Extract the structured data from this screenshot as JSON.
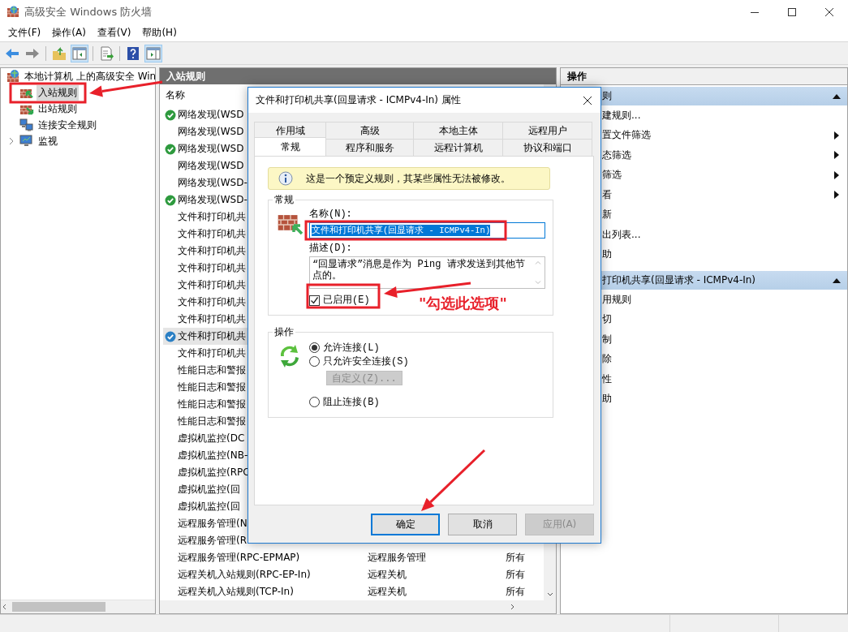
{
  "window": {
    "title": "高级安全 Windows 防火墙"
  },
  "menu": [
    "文件(F)",
    "操作(A)",
    "查看(V)",
    "帮助(H)"
  ],
  "tree": {
    "root": "本地计算机 上的高级安全 Win",
    "children": [
      {
        "label": "入站规则",
        "selected": true,
        "kind": "inbound"
      },
      {
        "label": "出站规则",
        "selected": false,
        "kind": "outbound"
      },
      {
        "label": "连接安全规则",
        "selected": false,
        "kind": "security"
      },
      {
        "label": "监视",
        "selected": false,
        "kind": "monitor"
      }
    ]
  },
  "rules_panel": {
    "title": "入站规则",
    "columns": [
      "名称"
    ],
    "rows": [
      {
        "name": "网络发现(WSD",
        "enabled": true,
        "selected": false
      },
      {
        "name": "网络发现(WSD",
        "enabled": false,
        "selected": false
      },
      {
        "name": "网络发现(WSD",
        "enabled": true,
        "selected": false
      },
      {
        "name": "网络发现(WSD",
        "enabled": false,
        "selected": false
      },
      {
        "name": "网络发现(WSD-",
        "enabled": false,
        "selected": false
      },
      {
        "name": "网络发现(WSD-",
        "enabled": true,
        "selected": false
      },
      {
        "name": "文件和打印机共",
        "enabled": false,
        "selected": false
      },
      {
        "name": "文件和打印机共",
        "enabled": false,
        "selected": false
      },
      {
        "name": "文件和打印机共",
        "enabled": false,
        "selected": false
      },
      {
        "name": "文件和打印机共",
        "enabled": false,
        "selected": false
      },
      {
        "name": "文件和打印机共",
        "enabled": false,
        "selected": false
      },
      {
        "name": "文件和打印机共",
        "enabled": false,
        "selected": false
      },
      {
        "name": "文件和打印机共",
        "enabled": false,
        "selected": false
      },
      {
        "name": "文件和打印机共",
        "enabled": true,
        "selected": true
      },
      {
        "name": "文件和打印机共",
        "enabled": false,
        "selected": false
      },
      {
        "name": "性能日志和警报",
        "enabled": false,
        "selected": false
      },
      {
        "name": "性能日志和警报",
        "enabled": false,
        "selected": false
      },
      {
        "name": "性能日志和警报",
        "enabled": false,
        "selected": false
      },
      {
        "name": "性能日志和警报",
        "enabled": false,
        "selected": false
      },
      {
        "name": "虚拟机监控(DC",
        "enabled": false,
        "selected": false
      },
      {
        "name": "虚拟机监控(NB-",
        "enabled": false,
        "selected": false
      },
      {
        "name": "虚拟机监控(RPC",
        "enabled": false,
        "selected": false
      },
      {
        "name": "虚拟机监控(回",
        "enabled": false,
        "selected": false
      },
      {
        "name": "虚拟机监控(回",
        "enabled": false,
        "selected": false
      },
      {
        "name": "远程服务管理(N",
        "enabled": false,
        "selected": false
      },
      {
        "name": "远程服务管理(R",
        "enabled": false,
        "selected": false
      },
      {
        "name": "远程服务管理(RPC-EPMAP)",
        "group": "远程服务管理",
        "profile": "所有",
        "enabled": false,
        "selected": false
      },
      {
        "name": "远程关机入站规则(RPC-EP-In)",
        "group": "远程关机",
        "profile": "所有",
        "enabled": false,
        "selected": false
      },
      {
        "name": "远程关机入站规则(TCP-In)",
        "group": "远程关机",
        "profile": "所有",
        "enabled": false,
        "selected": false
      }
    ]
  },
  "actions_panel": {
    "title": "操作",
    "sections": [
      {
        "title": "则",
        "items": [
          {
            "label": "建规则...",
            "submenu": false
          },
          {
            "label": "置文件筛选",
            "submenu": true
          },
          {
            "label": "态筛选",
            "submenu": true
          },
          {
            "label": "筛选",
            "submenu": true
          },
          {
            "label": "看",
            "submenu": true
          },
          {
            "label": "新",
            "submenu": false
          },
          {
            "label": "出列表...",
            "submenu": false
          },
          {
            "label": "助",
            "submenu": false
          }
        ]
      },
      {
        "title": "打印机共享(回显请求 - ICMPv4-In)",
        "items": [
          {
            "label": "用规则",
            "submenu": false
          },
          {
            "label": "切",
            "submenu": false
          },
          {
            "label": "制",
            "submenu": false
          },
          {
            "label": "除",
            "submenu": false
          },
          {
            "label": "性",
            "submenu": false
          },
          {
            "label": "助",
            "submenu": false
          }
        ]
      }
    ]
  },
  "dialog": {
    "title": "文件和打印机共享(回显请求 - ICMPv4-In) 属性",
    "tab_rows": [
      [
        {
          "label": "作用域",
          "selected": false
        },
        {
          "label": "高级",
          "selected": false
        },
        {
          "label": "本地主体",
          "selected": false
        },
        {
          "label": "远程用户",
          "selected": false
        }
      ],
      [
        {
          "label": "常规",
          "selected": true
        },
        {
          "label": "程序和服务",
          "selected": false
        },
        {
          "label": "远程计算机",
          "selected": false
        },
        {
          "label": "协议和端口",
          "selected": false
        }
      ]
    ],
    "info": "这是一个预定义规则，其某些属性无法被修改。",
    "general": {
      "legend": "常规",
      "name_label": "名称(N):",
      "name_value": "文件和打印机共享(回显请求 - ICMPv4-In)",
      "description_label": "描述(D):",
      "description": "“回显请求”消息是作为 Ping 请求发送到其他节点的。",
      "enabled_label": "已启用(E)",
      "enabled": true
    },
    "action": {
      "legend": "操作",
      "options": [
        {
          "kind": "radio",
          "label": "允许连接(L)",
          "selected": true
        },
        {
          "kind": "radio",
          "label": "只允许安全连接(S)",
          "selected": false
        },
        {
          "kind": "button",
          "label": "自定义(Z)...",
          "disabled": true
        },
        {
          "kind": "radio",
          "label": "阻止连接(B)",
          "selected": false
        }
      ]
    },
    "buttons": [
      {
        "label": "确定",
        "default": true,
        "disabled": false
      },
      {
        "label": "取消",
        "default": false,
        "disabled": false
      },
      {
        "label": "应用(A)",
        "default": false,
        "disabled": true
      }
    ]
  },
  "annotations": {
    "callout": "\"勾选此选项\""
  }
}
